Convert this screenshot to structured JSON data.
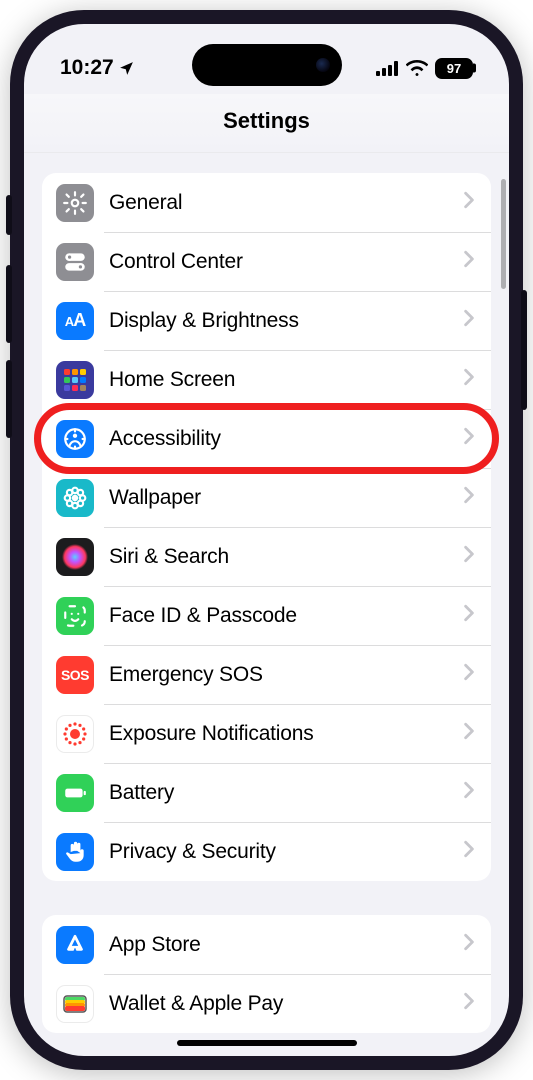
{
  "status": {
    "time": "10:27",
    "battery": "97"
  },
  "header": {
    "title": "Settings"
  },
  "groups": [
    {
      "rows": [
        {
          "id": "general",
          "label": "General",
          "icon": "gear",
          "bg": "#8e8e93"
        },
        {
          "id": "control-center",
          "label": "Control Center",
          "icon": "toggles",
          "bg": "#8e8e93"
        },
        {
          "id": "display",
          "label": "Display & Brightness",
          "icon": "aa",
          "bg": "#0a7aff"
        },
        {
          "id": "home-screen",
          "label": "Home Screen",
          "icon": "grid",
          "bg": "#3a3a9e"
        },
        {
          "id": "accessibility",
          "label": "Accessibility",
          "icon": "person-circle",
          "bg": "#0a7aff",
          "highlighted": true
        },
        {
          "id": "wallpaper",
          "label": "Wallpaper",
          "icon": "flower",
          "bg": "#19b9c9"
        },
        {
          "id": "siri",
          "label": "Siri & Search",
          "icon": "siri",
          "bg": "#1c1c1e"
        },
        {
          "id": "faceid",
          "label": "Face ID & Passcode",
          "icon": "face",
          "bg": "#30d158"
        },
        {
          "id": "sos",
          "label": "Emergency SOS",
          "icon": "sos",
          "bg": "#ff3b30"
        },
        {
          "id": "exposure",
          "label": "Exposure Notifications",
          "icon": "exposure",
          "bg": "#ffffff"
        },
        {
          "id": "battery",
          "label": "Battery",
          "icon": "battery",
          "bg": "#30d158"
        },
        {
          "id": "privacy",
          "label": "Privacy & Security",
          "icon": "hand",
          "bg": "#0a7aff"
        }
      ]
    },
    {
      "rows": [
        {
          "id": "appstore",
          "label": "App Store",
          "icon": "appstore",
          "bg": "#0a7aff"
        },
        {
          "id": "wallet",
          "label": "Wallet & Apple Pay",
          "icon": "wallet",
          "bg": "#1c1c1e"
        }
      ]
    }
  ]
}
